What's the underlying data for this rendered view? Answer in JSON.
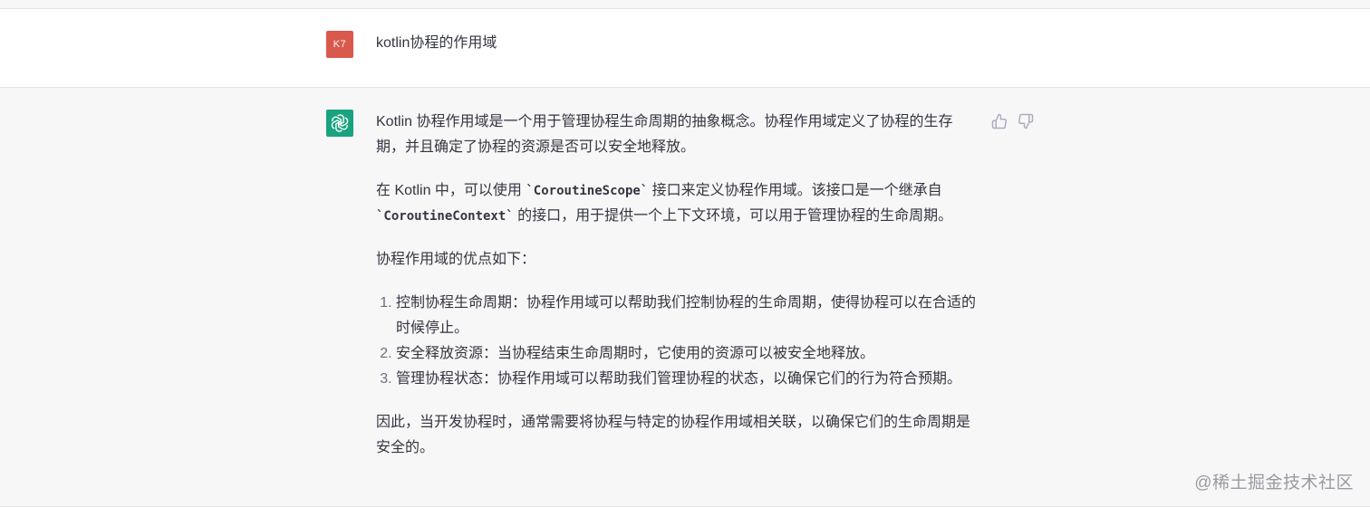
{
  "conversation": {
    "user": {
      "avatar_initials": "K7",
      "avatar_color": "#d9594c",
      "message": "kotlin协程的作用域"
    },
    "assistant": {
      "avatar_icon": "openai-logo-icon",
      "avatar_color": "#19a37f",
      "paragraphs": [
        "Kotlin 协程作用域是一个用于管理协程生命周期的抽象概念。协程作用域定义了协程的生存期，并且确定了协程的资源是否可以安全地释放。"
      ],
      "para2": {
        "text1": "在 Kotlin 中，可以使用 ",
        "code1": "`CoroutineScope`",
        "text2": " 接口来定义协程作用域。该接口是一个继承自 ",
        "code2": "`CoroutineContext`",
        "text3": " 的接口，用于提供一个上下文环境，可以用于管理协程的生命周期。"
      },
      "list_intro": "协程作用域的优点如下：",
      "list_items": [
        "控制协程生命周期：协程作用域可以帮助我们控制协程的生命周期，使得协程可以在合适的时候停止。",
        "安全释放资源：当协程结束生命周期时，它使用的资源可以被安全地释放。",
        "管理协程状态：协程作用域可以帮助我们管理协程的状态，以确保它们的行为符合预期。"
      ],
      "conclusion": "因此，当开发协程时，通常需要将协程与特定的协程作用域相关联，以确保它们的生命周期是安全的。"
    }
  },
  "feedback": {
    "thumbs_up_icon": "thumbs-up-icon",
    "thumbs_down_icon": "thumbs-down-icon"
  },
  "watermark": "@稀土掘金技术社区"
}
